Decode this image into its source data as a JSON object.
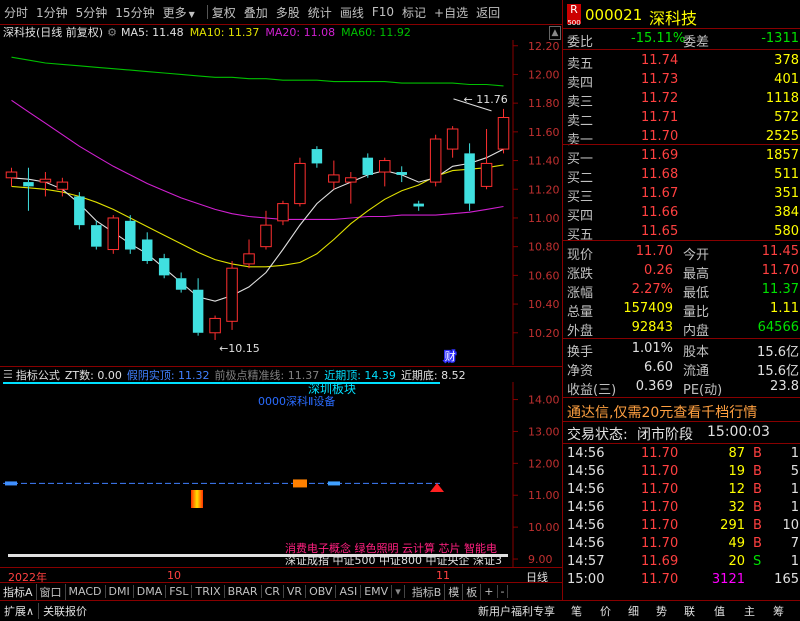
{
  "toolbar": {
    "left": [
      "分时",
      "1分钟",
      "5分钟",
      "15分钟",
      "更多"
    ],
    "right": [
      "复权",
      "叠加",
      "多股",
      "统计",
      "画线",
      "F10",
      "标记",
      "+自选",
      "返回"
    ]
  },
  "infobar": {
    "title": "深科技(日线 前复权)",
    "ma5": "MA5: 11.48",
    "ma10": "MA10: 11.37",
    "ma20": "MA20: 11.08",
    "ma60": "MA60: 11.92"
  },
  "chart_data": {
    "type": "candlestick",
    "yticks": [
      "12.20",
      "12.00",
      "11.80",
      "11.60",
      "11.40",
      "11.20",
      "11.00",
      "10.80",
      "10.60",
      "10.40",
      "10.20"
    ],
    "ylim": [
      10.08,
      12.24
    ],
    "annotations": {
      "high": "11.76",
      "low": "10.15",
      "cai": "财"
    },
    "xlabels": [
      "2022年",
      "10",
      "11"
    ],
    "candles": [
      {
        "o": 11.28,
        "h": 11.35,
        "l": 11.22,
        "c": 11.32
      },
      {
        "o": 11.25,
        "h": 11.35,
        "l": 11.05,
        "c": 11.22
      },
      {
        "o": 11.25,
        "h": 11.32,
        "l": 11.15,
        "c": 11.27
      },
      {
        "o": 11.2,
        "h": 11.28,
        "l": 11.15,
        "c": 11.25
      },
      {
        "o": 11.15,
        "h": 11.18,
        "l": 10.92,
        "c": 10.95
      },
      {
        "o": 10.95,
        "h": 10.98,
        "l": 10.78,
        "c": 10.8
      },
      {
        "o": 10.78,
        "h": 11.02,
        "l": 10.75,
        "c": 11.0
      },
      {
        "o": 10.98,
        "h": 11.02,
        "l": 10.75,
        "c": 10.78
      },
      {
        "o": 10.85,
        "h": 10.9,
        "l": 10.68,
        "c": 10.7
      },
      {
        "o": 10.72,
        "h": 10.75,
        "l": 10.58,
        "c": 10.6
      },
      {
        "o": 10.58,
        "h": 10.62,
        "l": 10.48,
        "c": 10.5
      },
      {
        "o": 10.5,
        "h": 10.58,
        "l": 10.18,
        "c": 10.2
      },
      {
        "o": 10.2,
        "h": 10.32,
        "l": 10.15,
        "c": 10.3
      },
      {
        "o": 10.28,
        "h": 10.7,
        "l": 10.22,
        "c": 10.65
      },
      {
        "o": 10.68,
        "h": 10.85,
        "l": 10.65,
        "c": 10.75
      },
      {
        "o": 10.8,
        "h": 11.05,
        "l": 10.78,
        "c": 10.95
      },
      {
        "o": 10.98,
        "h": 11.12,
        "l": 10.95,
        "c": 11.1
      },
      {
        "o": 11.1,
        "h": 11.42,
        "l": 11.08,
        "c": 11.38
      },
      {
        "o": 11.48,
        "h": 11.5,
        "l": 11.35,
        "c": 11.38
      },
      {
        "o": 11.25,
        "h": 11.4,
        "l": 11.2,
        "c": 11.3
      },
      {
        "o": 11.25,
        "h": 11.32,
        "l": 11.1,
        "c": 11.28
      },
      {
        "o": 11.42,
        "h": 11.45,
        "l": 11.28,
        "c": 11.3
      },
      {
        "o": 11.32,
        "h": 11.42,
        "l": 11.22,
        "c": 11.4
      },
      {
        "o": 11.32,
        "h": 11.36,
        "l": 11.25,
        "c": 11.3
      },
      {
        "o": 11.1,
        "h": 11.12,
        "l": 11.05,
        "c": 11.08
      },
      {
        "o": 11.25,
        "h": 11.58,
        "l": 11.22,
        "c": 11.55
      },
      {
        "o": 11.48,
        "h": 11.64,
        "l": 11.42,
        "c": 11.62
      },
      {
        "o": 11.45,
        "h": 11.52,
        "l": 11.05,
        "c": 11.1
      },
      {
        "o": 11.22,
        "h": 11.62,
        "l": 11.2,
        "c": 11.38
      },
      {
        "o": 11.48,
        "h": 11.76,
        "l": 11.45,
        "c": 11.7
      }
    ],
    "ma_lines": [
      {
        "name": "MA60",
        "color": "#00c000",
        "values": [
          12.12,
          12.1,
          12.08,
          12.07,
          12.06,
          12.05,
          12.04,
          12.03,
          12.02,
          12.01,
          12.0,
          11.99,
          11.98,
          11.98,
          11.97,
          11.97,
          11.96,
          11.96,
          11.96,
          11.95,
          11.95,
          11.95,
          11.95,
          11.94,
          11.94,
          11.94,
          11.94,
          11.93,
          11.93,
          11.92
        ]
      },
      {
        "name": "MA20",
        "color": "#d020d0",
        "values": [
          11.82,
          11.74,
          11.66,
          11.58,
          11.5,
          11.43,
          11.36,
          11.3,
          11.24,
          11.19,
          11.14,
          11.1,
          11.06,
          11.03,
          11.01,
          11.0,
          10.99,
          10.99,
          10.99,
          10.99,
          11.0,
          11.01,
          11.01,
          11.02,
          11.02,
          11.02,
          11.03,
          11.04,
          11.06,
          11.08
        ]
      },
      {
        "name": "MA10",
        "color": "#e0e000",
        "values": [
          11.22,
          11.21,
          11.2,
          11.18,
          11.15,
          11.11,
          11.06,
          11.0,
          10.94,
          10.88,
          10.82,
          10.76,
          10.71,
          10.68,
          10.66,
          10.66,
          10.67,
          10.69,
          10.75,
          10.85,
          10.96,
          11.05,
          11.13,
          11.19,
          11.23,
          11.29,
          11.33,
          11.34,
          11.35,
          11.37
        ]
      },
      {
        "name": "MA5",
        "color": "#e0e0e0",
        "values": [
          11.28,
          11.27,
          11.25,
          11.2,
          11.1,
          10.98,
          10.9,
          10.82,
          10.75,
          10.65,
          10.55,
          10.45,
          10.42,
          10.46,
          10.52,
          10.62,
          10.78,
          10.95,
          11.1,
          11.2,
          11.25,
          11.3,
          11.33,
          11.3,
          11.25,
          11.28,
          11.36,
          11.38,
          11.42,
          11.48
        ]
      }
    ]
  },
  "indicator": {
    "title": "指标公式",
    "zt": "ZT数: 0.00",
    "fake": "假阴实顶: 11.32",
    "precise": "前极点精准线: 11.37",
    "top": "近期顶: 14.39",
    "bottom": "近期底: 8.52",
    "yticks": [
      "14.00",
      "13.00",
      "12.00",
      "11.00",
      "10.00",
      "9.00"
    ],
    "label1": "深圳板块",
    "label2": "0000深科Ⅱ设备",
    "concepts": "消费电子概念 绿色照明 云计算 芯片 智能电",
    "indices": "深证成指 中证500 中证800 中证央企 深证3"
  },
  "xaxis": {
    "year": "2022年",
    "m10": "10",
    "m11": "11",
    "period": "日线"
  },
  "tabs": [
    "指标A",
    "窗口",
    "MACD",
    "DMI",
    "DMA",
    "FSL",
    "TRIX",
    "BRAR",
    "CR",
    "VR",
    "OBV",
    "ASI",
    "EMV",
    "指标B",
    "模",
    "板",
    "+",
    "-"
  ],
  "bottom": {
    "left": [
      "扩展∧",
      "关联报价"
    ],
    "center": "新用户福利专享",
    "icons": [
      "笔",
      "价",
      "细",
      "势",
      "联",
      "值",
      "主",
      "筹"
    ]
  },
  "quote": {
    "r_badge": "R",
    "r_sub": "500",
    "code": "000021",
    "name": "深科技",
    "weibi_label": "委比",
    "weibi": "-15.11%",
    "weicha_label": "委差",
    "weicha": "-1311",
    "asks": [
      {
        "label": "卖五",
        "price": "11.74",
        "vol": "378"
      },
      {
        "label": "卖四",
        "price": "11.73",
        "vol": "401"
      },
      {
        "label": "卖三",
        "price": "11.72",
        "vol": "1118"
      },
      {
        "label": "卖二",
        "price": "11.71",
        "vol": "572"
      },
      {
        "label": "卖一",
        "price": "11.70",
        "vol": "2525"
      }
    ],
    "bids": [
      {
        "label": "买一",
        "price": "11.69",
        "vol": "1857"
      },
      {
        "label": "买二",
        "price": "11.68",
        "vol": "511"
      },
      {
        "label": "买三",
        "price": "11.67",
        "vol": "351"
      },
      {
        "label": "买四",
        "price": "11.66",
        "vol": "384"
      },
      {
        "label": "买五",
        "price": "11.65",
        "vol": "580"
      }
    ],
    "stats": [
      {
        "l1": "现价",
        "v1": "11.70",
        "l2": "今开",
        "v2": "11.45"
      },
      {
        "l1": "涨跌",
        "v1": "0.26",
        "l2": "最高",
        "v2": "11.70"
      },
      {
        "l1": "涨幅",
        "v1": "2.27%",
        "l2": "最低",
        "v2": "11.37"
      },
      {
        "l1": "总量",
        "v1": "157409",
        "l2": "量比",
        "v2": "1.11"
      },
      {
        "l1": "外盘",
        "v1": "92843",
        "l2": "内盘",
        "v2": "64566"
      }
    ],
    "stats2": [
      {
        "l1": "换手",
        "v1": "1.01%",
        "l2": "股本",
        "v2": "15.6亿"
      },
      {
        "l1": "净资",
        "v1": "6.60",
        "l2": "流通",
        "v2": "15.6亿"
      },
      {
        "l1": "收益(三)",
        "v1": "0.369",
        "l2": "PE(动)",
        "v2": "23.8"
      }
    ],
    "ad": "通达信,仅需20元查看千档行情",
    "trade_status_label": "交易状态:",
    "trade_status": "闭市阶段",
    "trade_time": "15:00:03",
    "ticks": [
      {
        "t": "14:56",
        "p": "11.70",
        "v": "87",
        "d": "B"
      },
      {
        "t": "14:56",
        "p": "11.70",
        "v": "19",
        "d": "B"
      },
      {
        "t": "14:56",
        "p": "11.70",
        "v": "12",
        "d": "B"
      },
      {
        "t": "14:56",
        "p": "11.70",
        "v": "32",
        "d": "B"
      },
      {
        "t": "14:56",
        "p": "11.70",
        "v": "291",
        "d": "B"
      },
      {
        "t": "14:56",
        "p": "11.70",
        "v": "49",
        "d": "B"
      },
      {
        "t": "14:57",
        "p": "11.69",
        "v": "20",
        "d": "S"
      },
      {
        "t": "15:00",
        "p": "11.70",
        "v": "3121",
        "d": ""
      }
    ],
    "tick_extra": [
      "1",
      "5",
      "1",
      "1",
      "10",
      "7",
      "1",
      "165"
    ]
  }
}
